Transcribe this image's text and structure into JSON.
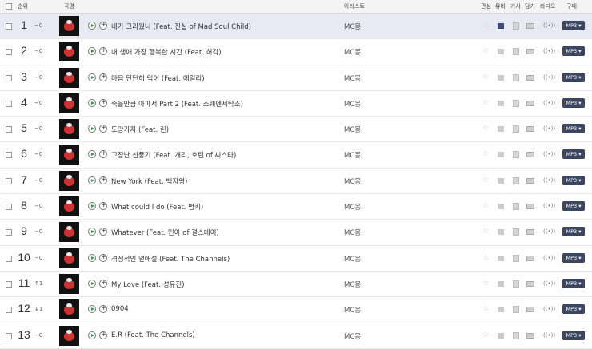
{
  "header": {
    "rank": "순위",
    "song": "곡명",
    "artist": "아티스트",
    "like": "관심",
    "mv": "뮤비",
    "lyrics": "가사",
    "put": "담기",
    "radio": "라디오",
    "buy": "구매"
  },
  "row_labels": {
    "radio": "((•))",
    "buy": "MP3 ▾",
    "star": "☆"
  },
  "rows": [
    {
      "rank": "1",
      "change": "−0",
      "dir": "same",
      "title": "내가 그리웠니 (Feat. 진실 of Mad Soul Child)",
      "artist": "MC몽",
      "selected": true
    },
    {
      "rank": "2",
      "change": "−0",
      "dir": "same",
      "title": "내 생애 가장 행복한 시간 (Feat. 허각)",
      "artist": "MC몽"
    },
    {
      "rank": "3",
      "change": "−0",
      "dir": "same",
      "title": "마음 단단히 먹어 (Feat. 에일리)",
      "artist": "MC몽"
    },
    {
      "rank": "4",
      "change": "−0",
      "dir": "same",
      "title": "죽을만큼 아파서 Part 2 (Feat. 스웨덴세탁소)",
      "artist": "MC몽"
    },
    {
      "rank": "5",
      "change": "−0",
      "dir": "same",
      "title": "도망가자 (Feat. 린)",
      "artist": "MC몽"
    },
    {
      "rank": "6",
      "change": "−0",
      "dir": "same",
      "title": "고장난 선풍기 (Feat. 개리, 호린 of 씨스타)",
      "artist": "MC몽"
    },
    {
      "rank": "7",
      "change": "−0",
      "dir": "same",
      "title": "New York (Feat. 백지영)",
      "artist": "MC몽"
    },
    {
      "rank": "8",
      "change": "−0",
      "dir": "same",
      "title": "What could I do (Feat. 범키)",
      "artist": "MC몽"
    },
    {
      "rank": "9",
      "change": "−0",
      "dir": "same",
      "title": "Whatever (Feat. 민아 of 걸스데이)",
      "artist": "MC몽"
    },
    {
      "rank": "10",
      "change": "−0",
      "dir": "same",
      "title": "격정적인 열애설 (Feat. The Channels)",
      "artist": "MC몽"
    },
    {
      "rank": "11",
      "change": "1",
      "dir": "up",
      "title": "My Love (Feat. 성유진)",
      "artist": "MC몽"
    },
    {
      "rank": "12",
      "change": "1",
      "dir": "down",
      "title": "0904",
      "artist": "MC몽"
    },
    {
      "rank": "13",
      "change": "−0",
      "dir": "same",
      "title": "E.R (Feat. The Channels)",
      "artist": "MC몽"
    }
  ]
}
